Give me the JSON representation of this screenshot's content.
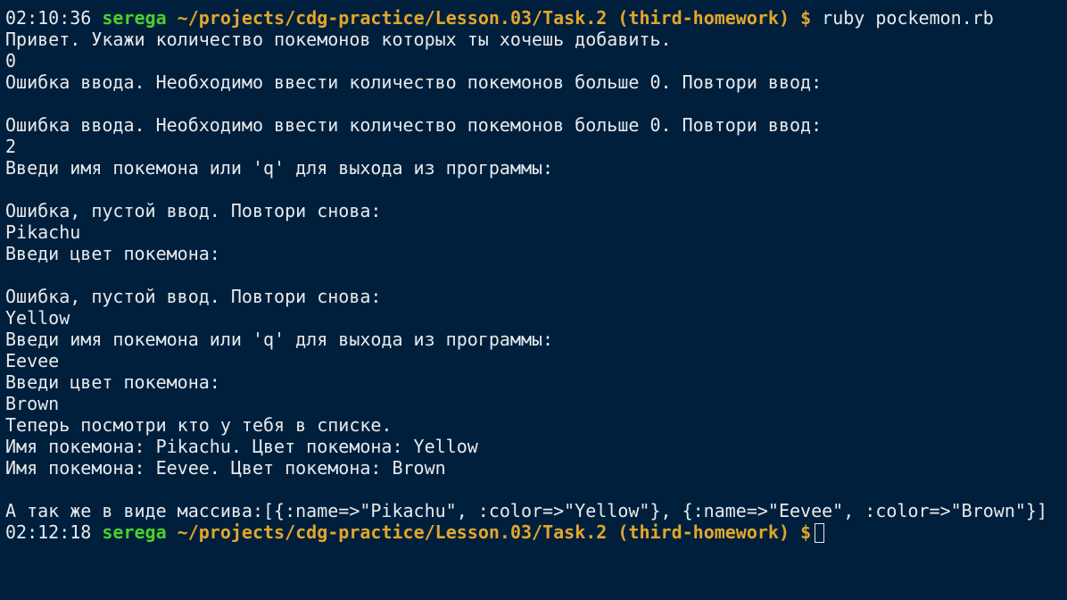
{
  "prompt1": {
    "time": "02:10:36",
    "user": "serega",
    "path": "~/projects/cdg-practice/Lesson.03/Task.2",
    "branch": "(third-homework)",
    "symbol": "$",
    "command": "ruby pockemon.rb"
  },
  "output": [
    "Привет. Укажи количество покемонов которых ты хочешь добавить.",
    "0",
    "Ошибка ввода. Необходимо ввести количество покемонов больше 0. Повтори ввод:",
    "",
    "Ошибка ввода. Необходимо ввести количество покемонов больше 0. Повтори ввод:",
    "2",
    "Введи имя покемона или 'q' для выхода из программы:",
    "",
    "Ошибка, пустой ввод. Повтори снова:",
    "Pikachu",
    "Введи цвет покемона:",
    "",
    "Ошибка, пустой ввод. Повтори снова:",
    "Yellow",
    "Введи имя покемона или 'q' для выхода из программы:",
    "Eevee",
    "Введи цвет покемона:",
    "Brown",
    "Теперь посмотри кто у тебя в списке.",
    "Имя покемона: Pikachu. Цвет покемона: Yellow",
    "Имя покемона: Eevee. Цвет покемона: Brown",
    "",
    "А так же в виде массива:[{:name=>\"Pikachu\", :color=>\"Yellow\"}, {:name=>\"Eevee\", :color=>\"Brown\"}]"
  ],
  "prompt2": {
    "time": "02:12:18",
    "user": "serega",
    "path": "~/projects/cdg-practice/Lesson.03/Task.2",
    "branch": "(third-homework)",
    "symbol": "$"
  },
  "colors": {
    "background": "#001f3d",
    "text": "#e8eaea",
    "user": "#4bd12a",
    "path": "#e2a72a"
  }
}
